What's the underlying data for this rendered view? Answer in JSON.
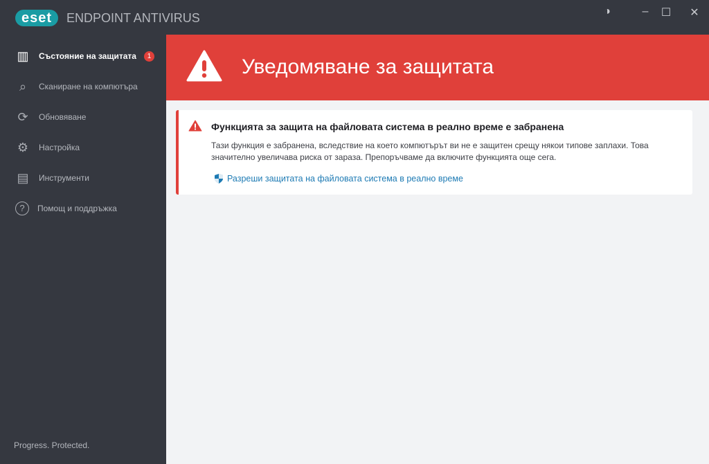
{
  "app": {
    "logo": "eset",
    "product": "ENDPOINT ANTIVIRUS"
  },
  "window": {
    "contrast": "◑",
    "minimize": "–",
    "maximize": "☐",
    "close": "✕"
  },
  "sidebar": {
    "items": [
      {
        "label": "Състояние на защитата",
        "icon": "dashboard-icon",
        "glyph": "▥",
        "badge": "1"
      },
      {
        "label": "Сканиране на компютъра",
        "icon": "search-icon",
        "glyph": "⌕"
      },
      {
        "label": "Обновяване",
        "icon": "refresh-icon",
        "glyph": "⟳"
      },
      {
        "label": "Настройка",
        "icon": "gear-icon",
        "glyph": "⚙"
      },
      {
        "label": "Инструменти",
        "icon": "toolbox-icon",
        "glyph": "▤"
      },
      {
        "label": "Помощ и поддръжка",
        "icon": "help-icon",
        "glyph": "?"
      }
    ],
    "footer": "Progress. Protected."
  },
  "banner": {
    "title": "Уведомяване за защитата"
  },
  "alert": {
    "title": "Функцията за защита на файловата система в реално време е забранена",
    "body": "Тази функция е забранена, вследствие на което компютърът ви не е защитен срещу някои типове заплахи. Това значително увеличава риска от зараза. Препоръчваме да включите функцията още сега.",
    "action": "Разреши защитата на файловата система в реално време"
  }
}
